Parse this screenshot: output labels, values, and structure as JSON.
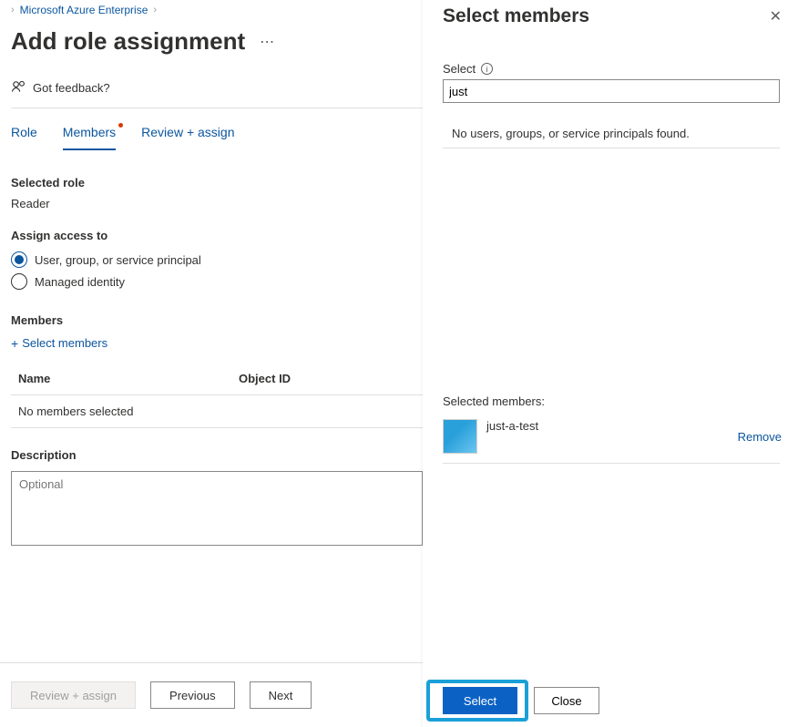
{
  "breadcrumb": {
    "link": "Microsoft Azure Enterprise"
  },
  "page": {
    "title": "Add role assignment"
  },
  "feedback": {
    "label": "Got feedback?"
  },
  "tabs": {
    "role": "Role",
    "members": "Members",
    "review": "Review + assign"
  },
  "selectedRole": {
    "label": "Selected role",
    "value": "Reader"
  },
  "assignAccess": {
    "label": "Assign access to",
    "opt1": "User, group, or service principal",
    "opt2": "Managed identity"
  },
  "members": {
    "label": "Members",
    "addLink": "Select members",
    "colName": "Name",
    "colObjId": "Object ID",
    "empty": "No members selected"
  },
  "description": {
    "label": "Description",
    "placeholder": "Optional"
  },
  "footer": {
    "review": "Review + assign",
    "prev": "Previous",
    "next": "Next"
  },
  "panel": {
    "title": "Select members",
    "selectLabel": "Select",
    "searchValue": "just",
    "noresults": "No users, groups, or service principals found.",
    "selectedLabel": "Selected members:",
    "item": {
      "name": "just-a-test",
      "removeLabel": "Remove"
    },
    "selectBtn": "Select",
    "closeBtn": "Close"
  }
}
